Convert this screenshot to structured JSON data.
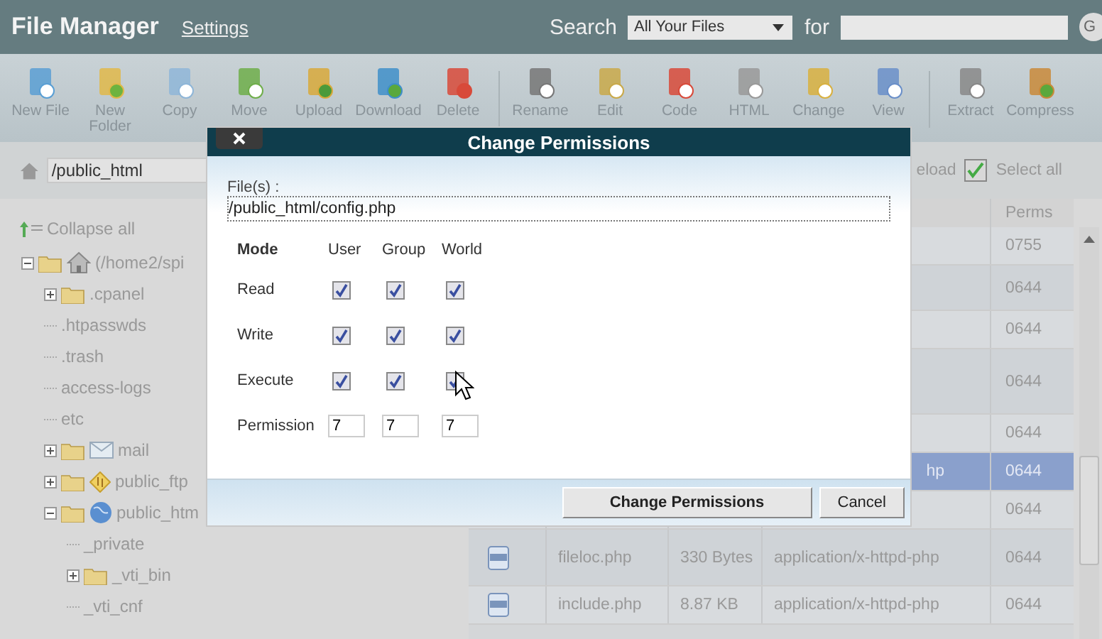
{
  "header": {
    "title": "File Manager",
    "settings_link": "Settings",
    "search_label": "Search",
    "search_scope": "All Your Files",
    "for_label": "for",
    "go_button": "G"
  },
  "toolbar": [
    [
      {
        "label": "New File"
      },
      {
        "label": "New Folder"
      },
      {
        "label": "Copy"
      },
      {
        "label": "Move"
      },
      {
        "label": "Upload"
      },
      {
        "label": "Download"
      },
      {
        "label": "Delete"
      }
    ],
    [
      {
        "label": "Rename"
      },
      {
        "label": "Edit"
      },
      {
        "label": "Code"
      },
      {
        "label": "HTML"
      },
      {
        "label": "Change"
      },
      {
        "label": "View"
      }
    ],
    [
      {
        "label": "Extract"
      },
      {
        "label": "Compress"
      }
    ]
  ],
  "path_field": "/public_html",
  "collapse_all": "Collapse all",
  "tree": [
    {
      "label": "(/home2/spi",
      "kind": "home",
      "expanded": true,
      "children": [
        {
          "label": ".cpanel",
          "kind": "folder",
          "expanded": false
        },
        {
          "label": ".htpasswds",
          "kind": "plain"
        },
        {
          "label": ".trash",
          "kind": "plain"
        },
        {
          "label": "access-logs",
          "kind": "plain"
        },
        {
          "label": "etc",
          "kind": "plain"
        },
        {
          "label": "mail",
          "kind": "mail",
          "expanded": false
        },
        {
          "label": "public_ftp",
          "kind": "ftp",
          "expanded": false
        },
        {
          "label": "public_htm",
          "kind": "web",
          "expanded": true,
          "children": [
            {
              "label": "_private",
              "kind": "plain"
            },
            {
              "label": "_vti_bin",
              "kind": "folder",
              "expanded": false
            },
            {
              "label": "_vti_cnf",
              "kind": "plain"
            }
          ]
        }
      ]
    }
  ],
  "table_bar": {
    "reload_fragment": "eload",
    "select_all": {
      "label": "Select all",
      "checked": true
    }
  },
  "table": {
    "perms_heading": "Perms",
    "rows": [
      {
        "perms": "0755",
        "selected": false
      },
      {
        "perms": "0644",
        "selected": false
      },
      {
        "perms": "0644",
        "selected": false
      },
      {
        "perms": "0644",
        "selected": false
      },
      {
        "perms": "0644",
        "selected": false
      },
      {
        "type": "hp",
        "perms": "0644",
        "selected": true
      },
      {
        "perms": "0644",
        "selected": false
      },
      {
        "name": "fileloc.php",
        "size": "330 Bytes",
        "type": "application/x-httpd-php",
        "perms": "0644",
        "selected": false
      },
      {
        "name": "include.php",
        "size": "8.87 KB",
        "type": "application/x-httpd-php",
        "perms": "0644",
        "selected": false
      }
    ]
  },
  "dialog": {
    "title": "Change Permissions",
    "files_label": "File(s) :",
    "file_path": "/public_html/config.php",
    "mode_heading": "Mode",
    "columns": [
      "User",
      "Group",
      "World"
    ],
    "rows": [
      {
        "label": "Read",
        "user": true,
        "group": true,
        "world": true
      },
      {
        "label": "Write",
        "user": true,
        "group": true,
        "world": true
      },
      {
        "label": "Execute",
        "user": true,
        "group": true,
        "world": true
      }
    ],
    "permission_label": "Permission",
    "permission_values": [
      "7",
      "7",
      "7"
    ],
    "primary_button": "Change Permissions",
    "cancel_button": "Cancel"
  }
}
